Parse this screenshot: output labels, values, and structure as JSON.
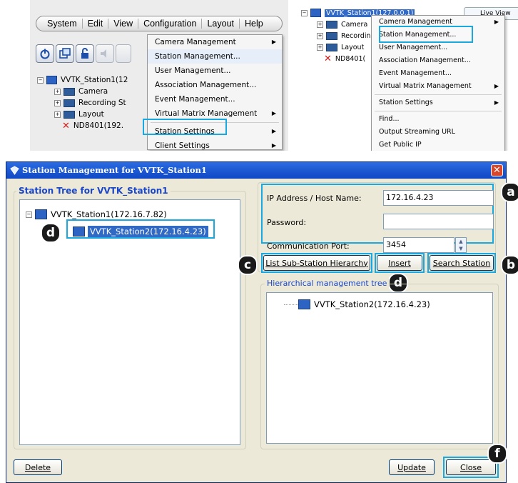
{
  "top_left": {
    "menubar": [
      "System",
      "Edit",
      "View",
      "Configuration",
      "Layout",
      "Help"
    ],
    "tree": {
      "root": "VVTK_Station1(12",
      "children": [
        "Camera",
        "Recording St",
        "Layout",
        "ND8401(192."
      ]
    },
    "menu": [
      {
        "label": "Camera Management",
        "arrow": true
      },
      {
        "label": "Station Management...",
        "arrow": false
      },
      {
        "label": "User Management...",
        "arrow": false
      },
      {
        "label": "Association Management...",
        "arrow": false
      },
      {
        "label": "Event Management...",
        "arrow": false
      },
      {
        "label": "Virtual Matrix Management",
        "arrow": true
      },
      {
        "label": "Station Settings",
        "arrow": true
      },
      {
        "label": "Client Settings",
        "arrow": true
      }
    ]
  },
  "top_right": {
    "tree": {
      "root": "VVTK_Station1(127.0.0.1)",
      "children": [
        "Camera",
        "Recording",
        "Layout",
        "ND8401("
      ]
    },
    "live_view": "Live View",
    "menu": [
      {
        "label": "Camera Management",
        "arrow": true
      },
      {
        "label": "Station Management...",
        "arrow": false
      },
      {
        "label": "User Management...",
        "arrow": false
      },
      {
        "label": "Association Management...",
        "arrow": false
      },
      {
        "label": "Event Management...",
        "arrow": false
      },
      {
        "label": "Virtual Matrix Management",
        "arrow": true
      },
      {
        "label": "Station Settings",
        "arrow": true
      },
      {
        "label": "Find...",
        "arrow": false
      },
      {
        "label": "Output Streaming URL",
        "arrow": false
      },
      {
        "label": "Get Public IP",
        "arrow": false
      }
    ]
  },
  "dialog": {
    "title": "Station Management for VVTK_Station1",
    "close_glyph": "✕",
    "station_tree": {
      "title": "Station Tree for VVTK_Station1",
      "root": "VVTK_Station1(172.16.7.82)",
      "child": "VVTK_Station2(172.16.4.23)"
    },
    "form": {
      "ip_label": "IP Address / Host Name:",
      "ip_value": "172.16.4.23",
      "password_label": "Password:",
      "password_value": "",
      "port_label": "Communication Port:",
      "port_value": "3454"
    },
    "buttons": {
      "list_sub": "List Sub-Station Hierarchy",
      "insert": "Insert",
      "search": "Search Station",
      "delete": "Delete",
      "update": "Update",
      "close": "Close"
    },
    "hier": {
      "title": "Hierarchical management tree",
      "item": "VVTK_Station2(172.16.4.23)"
    }
  },
  "callouts": {
    "a": "a",
    "b": "b",
    "c": "c",
    "d": "d",
    "f": "f"
  }
}
